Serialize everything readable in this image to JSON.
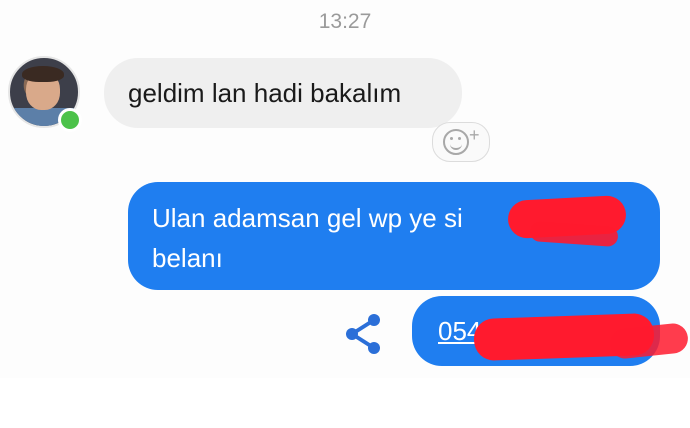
{
  "thread": {
    "timestamp": "13:27",
    "incoming": {
      "text": "geldim lan hadi bakalım",
      "sender_online": true,
      "reaction_plus": "+"
    },
    "outgoing": [
      {
        "line1": "Ulan adamsan gel wp ye si",
        "line2": "belanı",
        "redacted": true
      },
      {
        "text": "054",
        "type": "phone-link",
        "redacted": true
      }
    ]
  },
  "colors": {
    "outgoing_bubble": "#1f7ef0",
    "incoming_bubble": "#efefef",
    "online_indicator": "#4cc24a",
    "redaction": "#ff1a2e",
    "share_icon": "#2b6fd8"
  },
  "icons": {
    "reaction": "add-reaction-icon",
    "share": "share-icon",
    "status": "online-status-icon"
  }
}
